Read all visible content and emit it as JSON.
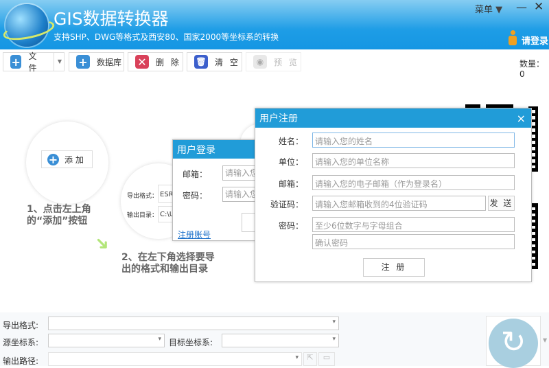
{
  "app": {
    "title": "GIS数据转换器",
    "subtitle": "支持SHP、DWG等格式及西安80、国家2000等坐标系的转换",
    "menu": "菜单",
    "login": "请登录"
  },
  "toolbar": {
    "file": "文 件",
    "database": "数据库",
    "delete": "删 除",
    "clear": "清 空",
    "preview": "预 览",
    "count": "数量：0"
  },
  "guide": {
    "add": "添 加",
    "step1": [
      "1、点击左上角",
      "的“添加”按钮"
    ],
    "step2": [
      "2、在左下角选择要导",
      "出的格式和输出目录"
    ],
    "format_label": "导出格式：",
    "format_value": "ESRI",
    "dir_label": "输出目录：",
    "dir_value": "C:\\U"
  },
  "login_dialog": {
    "title": "用户登录",
    "email_label": "邮箱：",
    "email_placeholder": "请输入您",
    "password_label": "密码：",
    "password_placeholder": "请输入您",
    "register_link": "注册账号"
  },
  "register_dialog": {
    "title": "用户注册",
    "close": "×",
    "fields": [
      {
        "label": "姓名：",
        "placeholder": "请输入您的姓名"
      },
      {
        "label": "单位：",
        "placeholder": "请输入您的单位名称"
      },
      {
        "label": "邮箱：",
        "placeholder": "请输入您的电子邮箱（作为登录名）"
      },
      {
        "label": "验证码：",
        "placeholder": "请输入您邮箱收到的4位验证码"
      },
      {
        "label": "密码：",
        "placeholder": "至少6位数字与字母组合"
      },
      {
        "label": "",
        "placeholder": "确认密码"
      }
    ],
    "send": "发 送",
    "submit": "注 册"
  },
  "bottom": {
    "format_label": "导出格式:",
    "source_label": "源坐标系:",
    "target_label": "目标坐标系:",
    "path_label": "输出路径:"
  },
  "colors": {
    "accent": "#219cd8",
    "add": "#3a8fd6",
    "delete": "#d9415a",
    "clear": "#3c5fcc"
  }
}
